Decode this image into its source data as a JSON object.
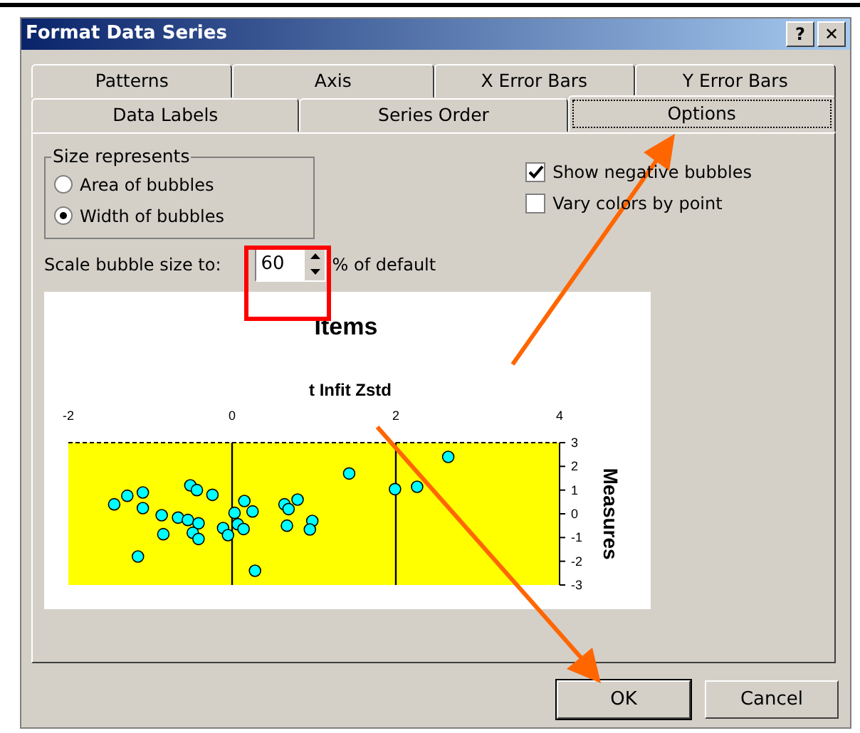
{
  "window": {
    "title": "Format Data Series",
    "buttons": [
      "?",
      "✕"
    ]
  },
  "tab_rows": [
    {
      "tabs": [
        {
          "label": "Patterns",
          "selected": false
        },
        {
          "label": "Axis",
          "selected": false
        },
        {
          "label": "X Error Bars",
          "selected": false
        },
        {
          "label": "Y Error Bars",
          "selected": false
        }
      ]
    },
    {
      "tabs": [
        {
          "label": "Data Labels",
          "selected": false
        },
        {
          "label": "Series Order",
          "selected": false
        },
        {
          "label": "Options",
          "selected": true
        }
      ]
    }
  ],
  "size_represents": {
    "title": "Size represents",
    "options": [
      {
        "label": "Area of bubbles",
        "selected": false
      },
      {
        "label": "Width of bubbles",
        "selected": true
      }
    ]
  },
  "checkboxes": [
    {
      "label": "Show negative bubbles",
      "checked": true
    },
    {
      "label": "Vary colors by point",
      "checked": false
    }
  ],
  "scale": {
    "label": "Scale bubble size to:",
    "value": "60",
    "suffix": "% of default"
  },
  "preview": {
    "chart_data": {
      "type": "scatter",
      "title": "Items",
      "xlabel": "t Infit Zstd",
      "ylabel": "Measures",
      "xlim": [
        -2,
        4
      ],
      "ylim": [
        -3,
        3
      ],
      "xticks": [
        -2,
        0,
        2,
        4
      ],
      "yticks": [
        3,
        2,
        1,
        0,
        -1,
        -2,
        -3
      ],
      "series": [
        {
          "color": "#00ffff",
          "x": [
            -1.44,
            -1.28,
            -1.09,
            -1.09,
            -0.86,
            -0.84,
            -1.15,
            -0.51,
            -0.43,
            -0.24,
            -0.66,
            -0.54,
            -0.41,
            -0.48,
            -0.41,
            -0.11,
            -0.05,
            0.03,
            0.07,
            0.14,
            0.15,
            0.25,
            0.28,
            0.64,
            0.67,
            0.8,
            0.69,
            0.98,
            0.95,
            1.43,
            1.99,
            2.26,
            2.64
          ],
          "values": [
            0.4,
            0.76,
            0.9,
            0.24,
            -0.06,
            -0.86,
            -1.8,
            1.2,
            1.0,
            0.8,
            -0.16,
            -0.26,
            -0.4,
            -0.8,
            -1.06,
            -0.6,
            -0.9,
            0.04,
            -0.44,
            -0.64,
            0.54,
            0.1,
            -2.4,
            0.4,
            -0.5,
            0.6,
            0.2,
            -0.3,
            -0.66,
            1.7,
            1.04,
            1.14,
            2.4
          ]
        }
      ]
    }
  },
  "buttons": [
    "OK",
    "Cancel"
  ]
}
